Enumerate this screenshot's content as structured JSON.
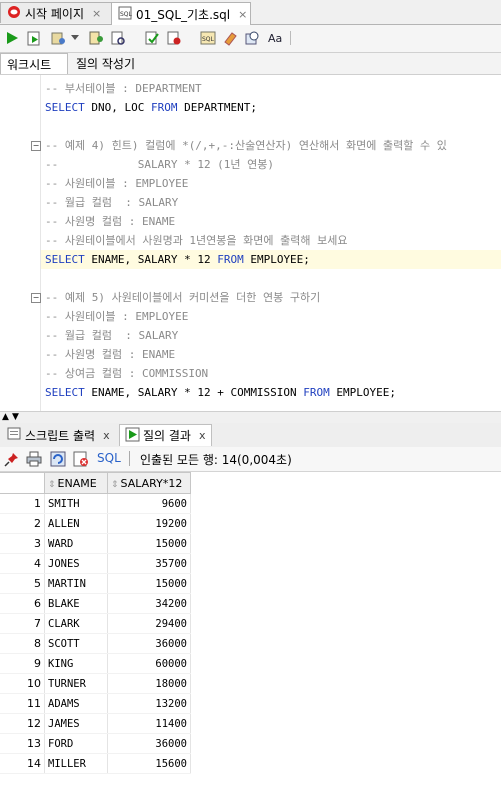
{
  "tabs": [
    {
      "label": "시작 페이지",
      "close": "×"
    },
    {
      "label": "01_SQL_기초.sql",
      "close": "×"
    }
  ],
  "subtabs": [
    "워크시트",
    "질의 작성기"
  ],
  "editor": {
    "lines": [
      {
        "parts": [
          [
            "cmt",
            "-- 부서테이블 : DEPARTMENT"
          ]
        ]
      },
      {
        "parts": [
          [
            "kw",
            "SELECT"
          ],
          [
            "",
            " DNO, LOC "
          ],
          [
            "kw",
            "FROM"
          ],
          [
            "",
            " DEPARTMENT;"
          ]
        ]
      },
      {
        "parts": [
          [
            "",
            ""
          ]
        ]
      },
      {
        "parts": [
          [
            "cmt",
            "-- 예제 4) 힌트) 컬럼에 *(/,+,-:산술연산자) 연산해서 화면에 출력할 수 있"
          ]
        ],
        "fold": "⊟"
      },
      {
        "parts": [
          [
            "cmt",
            "--            SALARY * 12 (1년 연봉)"
          ]
        ]
      },
      {
        "parts": [
          [
            "cmt",
            "-- 사원테이블 : EMPLOYEE"
          ]
        ]
      },
      {
        "parts": [
          [
            "cmt",
            "-- 월급 컬럼  : SALARY"
          ]
        ]
      },
      {
        "parts": [
          [
            "cmt",
            "-- 사원명 컬럼 : ENAME"
          ]
        ]
      },
      {
        "parts": [
          [
            "cmt",
            "-- 사원테이블에서 사원명과 1년연봉을 화면에 출력해 보세요"
          ]
        ]
      },
      {
        "parts": [
          [
            "kw",
            "SELECT"
          ],
          [
            "",
            " ENAME, SALARY * 12 "
          ],
          [
            "kw",
            "FROM"
          ],
          [
            "",
            " EMPLOYEE;"
          ]
        ],
        "hl": true
      },
      {
        "parts": [
          [
            "",
            ""
          ]
        ]
      },
      {
        "parts": [
          [
            "cmt",
            "-- 예제 5) 사원테이블에서 커미션을 더한 연봉 구하기"
          ]
        ],
        "fold": "⊟"
      },
      {
        "parts": [
          [
            "cmt",
            "-- 사원테이블 : EMPLOYEE"
          ]
        ]
      },
      {
        "parts": [
          [
            "cmt",
            "-- 월급 컬럼  : SALARY"
          ]
        ]
      },
      {
        "parts": [
          [
            "cmt",
            "-- 사원명 컬럼 : ENAME"
          ]
        ]
      },
      {
        "parts": [
          [
            "cmt",
            "-- 상여금 컬럼 : COMMISSION"
          ]
        ]
      },
      {
        "parts": [
          [
            "kw",
            "SELECT"
          ],
          [
            "",
            " ENAME, SALARY * 12 + COMMISSION "
          ],
          [
            "kw",
            "FROM"
          ],
          [
            "",
            " EMPLOYEE;"
          ]
        ]
      }
    ]
  },
  "bottom_tabs": [
    {
      "label": "스크립트 출력",
      "close": "x"
    },
    {
      "label": "질의 결과",
      "close": "x"
    }
  ],
  "result_toolbar": {
    "sql_label": "SQL",
    "status": "인출된 모든 행: 14(0,004초)"
  },
  "results": {
    "columns": [
      "ENAME",
      "SALARY*12"
    ],
    "rows": [
      {
        "n": "1",
        "ename": "SMITH",
        "salary": "9600"
      },
      {
        "n": "2",
        "ename": "ALLEN",
        "salary": "19200"
      },
      {
        "n": "3",
        "ename": "WARD",
        "salary": "15000"
      },
      {
        "n": "4",
        "ename": "JONES",
        "salary": "35700"
      },
      {
        "n": "5",
        "ename": "MARTIN",
        "salary": "15000"
      },
      {
        "n": "6",
        "ename": "BLAKE",
        "salary": "34200"
      },
      {
        "n": "7",
        "ename": "CLARK",
        "salary": "29400"
      },
      {
        "n": "8",
        "ename": "SCOTT",
        "salary": "36000"
      },
      {
        "n": "9",
        "ename": "KING",
        "salary": "60000"
      },
      {
        "n": "10",
        "ename": "TURNER",
        "salary": "18000"
      },
      {
        "n": "11",
        "ename": "ADAMS",
        "salary": "13200"
      },
      {
        "n": "12",
        "ename": "JAMES",
        "salary": "11400"
      },
      {
        "n": "13",
        "ename": "FORD",
        "salary": "36000"
      },
      {
        "n": "14",
        "ename": "MILLER",
        "salary": "15600"
      }
    ]
  },
  "colors": {
    "keyword": "#1f3fbf",
    "comment": "#8a8a8a",
    "highlight": "#fffbe0"
  }
}
